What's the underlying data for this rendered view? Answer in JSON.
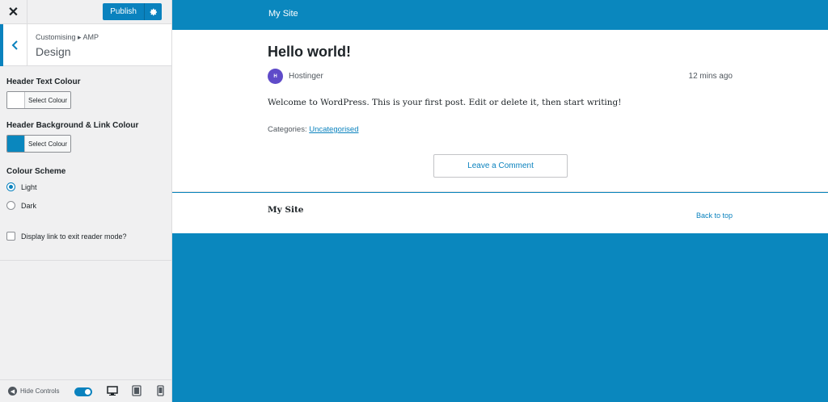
{
  "sidebar": {
    "close_label": "✕",
    "publish_label": "Publish",
    "breadcrumb": "Customising ▸ AMP",
    "section_title": "Design",
    "header_text_colour": {
      "label": "Header Text Colour",
      "button_label": "Select Colour",
      "swatch": "#ffffff"
    },
    "header_bg_colour": {
      "label": "Header Background & Link Colour",
      "button_label": "Select Colour",
      "swatch": "#0a87be"
    },
    "colour_scheme": {
      "label": "Colour Scheme",
      "options": [
        {
          "label": "Light",
          "checked": true
        },
        {
          "label": "Dark",
          "checked": false
        }
      ]
    },
    "exit_reader_mode": {
      "label": "Display link to exit reader mode?",
      "checked": false
    },
    "footer": {
      "hide_controls_label": "Hide Controls"
    }
  },
  "preview": {
    "site_name": "My Site",
    "post": {
      "title": "Hello world!",
      "avatar_text": "H",
      "author": "Hostinger",
      "time": "12 mins ago",
      "body": "Welcome to WordPress. This is your first post. Edit or delete it, then start writing!",
      "categories_label": "Categories:",
      "category": "Uncategorised",
      "comment_button": "Leave a Comment"
    },
    "footer": {
      "site_name": "My Site",
      "back_to_top": "Back to top"
    }
  },
  "colors": {
    "accent": "#0a82be",
    "header_bg": "#0a87be",
    "sidebar_bg": "#f0f0f1"
  }
}
